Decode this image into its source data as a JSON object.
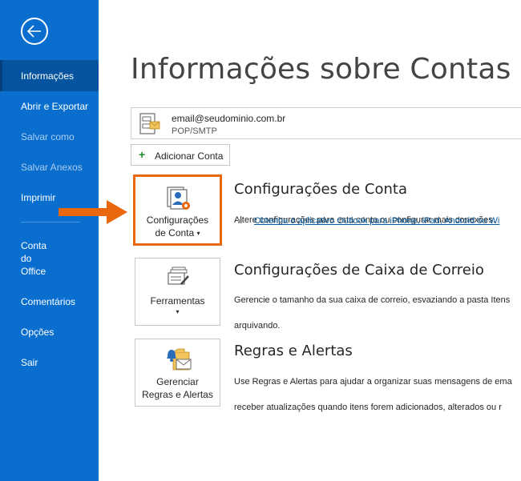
{
  "sidebar": {
    "items": [
      {
        "label": "Informações",
        "state": "active"
      },
      {
        "label": "Abrir e Exportar",
        "state": "normal"
      },
      {
        "label": "Salvar como",
        "state": "disabled"
      },
      {
        "label": "Salvar Anexos",
        "state": "disabled"
      },
      {
        "label": "Imprimir",
        "state": "normal"
      },
      {
        "label": "Conta\ndo\nOffice",
        "state": "normal"
      },
      {
        "label": "Comentários",
        "state": "normal"
      },
      {
        "label": "Opções",
        "state": "normal"
      },
      {
        "label": "Sair",
        "state": "normal"
      }
    ]
  },
  "main": {
    "title": "Informações sobre Contas",
    "account": {
      "email": "email@seudominio.com.br",
      "type": "POP/SMTP"
    },
    "add_account_label": "Adicionar Conta",
    "sections": [
      {
        "tile_label_1": "Configurações",
        "tile_label_2": "de Conta",
        "tile_caret": "▾",
        "title": "Configurações de Conta",
        "desc_1": "Altere configurações para esta conta ou configurar mais conexões.",
        "link": "Obtenha o aplicativo Outlook para iPhone, iPad, Android ou Wi"
      },
      {
        "tile_label_1": "Ferramentas",
        "tile_caret": "▾",
        "title": "Configurações de Caixa de Correio",
        "desc_1": "Gerencie o tamanho da sua caixa de correio, esvaziando a pasta Itens",
        "desc_2": "arquivando."
      },
      {
        "tile_label_1": "Gerenciar",
        "tile_label_2": "Regras e Alertas",
        "title": "Regras e Alertas",
        "desc_1": "Use Regras e Alertas para ajudar a organizar suas mensagens de ema",
        "desc_2": "receber atualizações quando itens forem adicionados, alterados ou r"
      }
    ]
  },
  "colors": {
    "sidebar": "#0a6ecf",
    "sidebar_active": "#06539f",
    "highlight": "#e9670d",
    "link": "#0b5fa5"
  },
  "icons": [
    "back-arrow-icon",
    "account-card-icon",
    "plus-icon",
    "account-settings-icon",
    "tools-icon",
    "rules-alerts-icon",
    "callout-arrow"
  ]
}
